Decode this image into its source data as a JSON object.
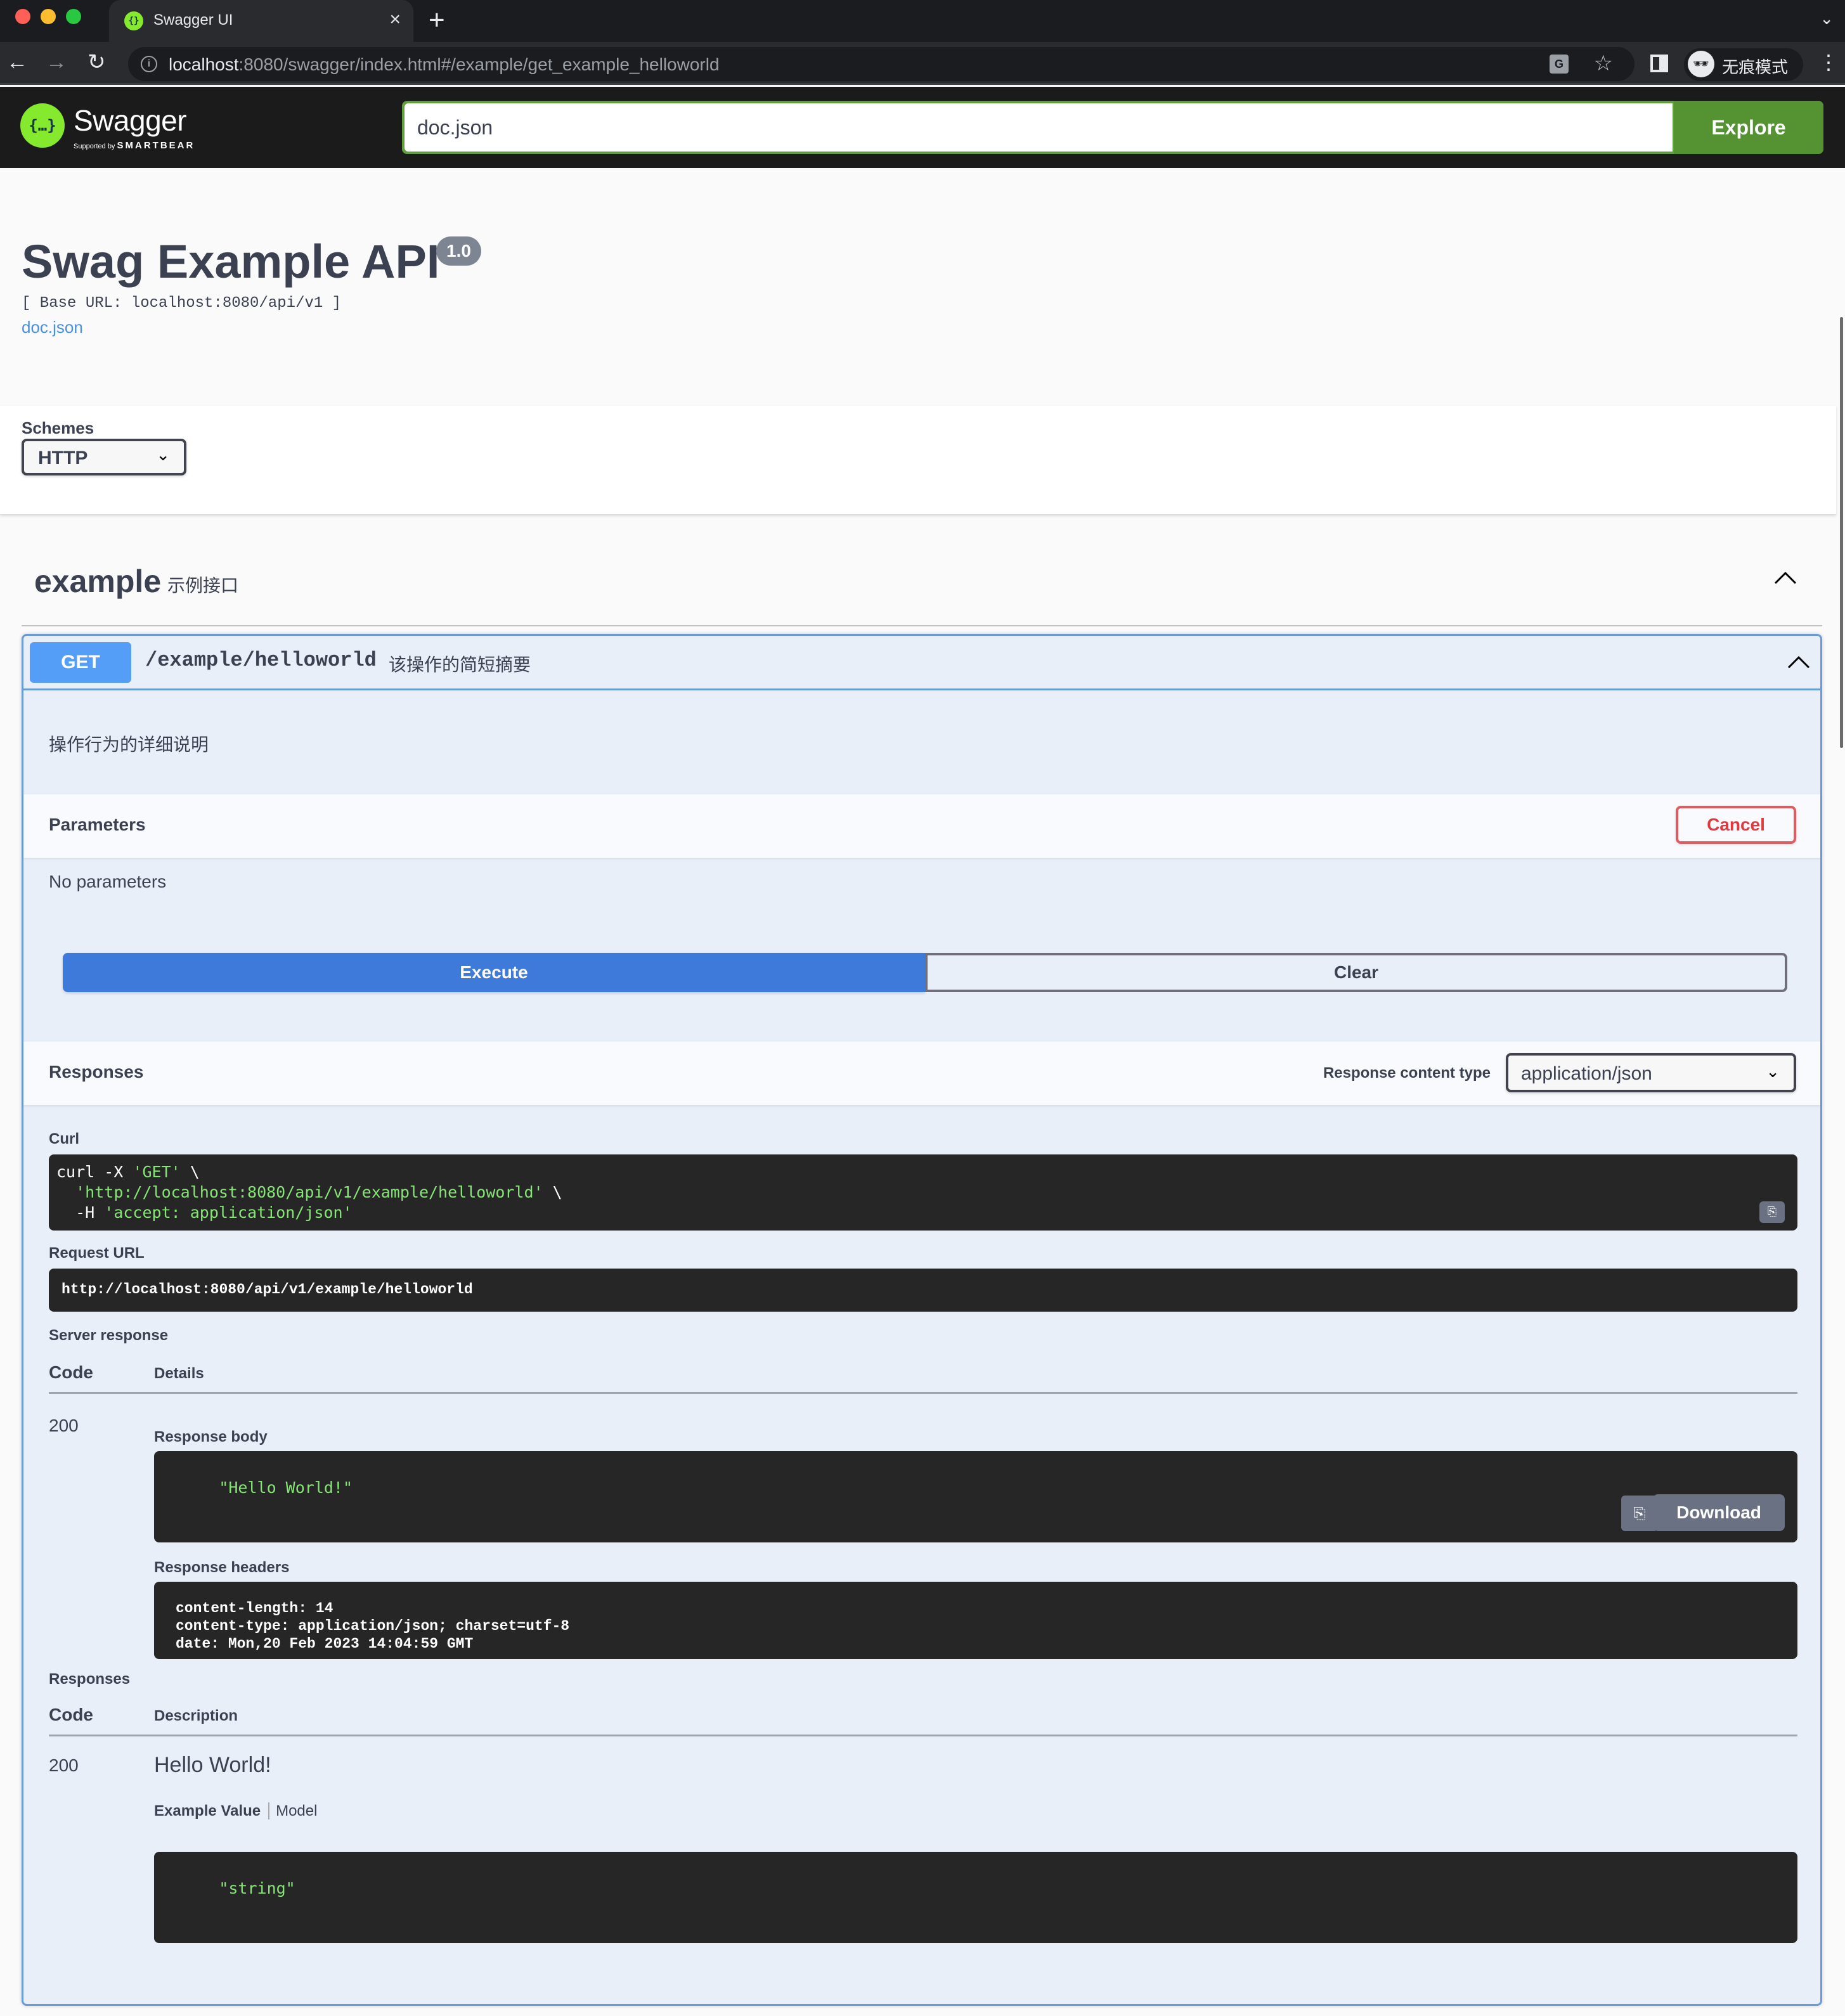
{
  "browser": {
    "tab_title": "Swagger UI",
    "url_host": "localhost",
    "url_rest": ":8080/swagger/index.html#/example/get_example_helloworld",
    "profile_label": "无痕模式",
    "icons": {
      "back": "arrow-left-icon",
      "forward": "arrow-right-icon",
      "reload": "reload-icon",
      "info": "info-icon",
      "translate": "translate-icon",
      "bookmark": "star-icon",
      "side_panel": "side-panel-icon",
      "incognito": "incognito-icon",
      "menu": "kebab-menu-icon"
    }
  },
  "topbar": {
    "logo_text": "Swagger",
    "logo_sub_prefix": "Supported by",
    "logo_sub_brand": "SMARTBEAR",
    "spec_url_value": "doc.json",
    "explore_label": "Explore",
    "colors": {
      "bg": "#1b1b1b",
      "accent": "#62a03f",
      "logo": "#85ea2d"
    }
  },
  "info": {
    "title": "Swag Example API",
    "version": "1.0",
    "base_url": "[ Base URL: localhost:8080/api/v1 ]",
    "spec_link": "doc.json"
  },
  "schemes": {
    "label": "Schemes",
    "selected": "HTTP"
  },
  "tag": {
    "name": "example",
    "description": "示例接口",
    "expanded": true
  },
  "operation": {
    "method": "GET",
    "path": "/example/helloworld",
    "summary": "该操作的简短摘要",
    "description": "操作行为的详细说明",
    "method_color": "#61affe",
    "parameters": {
      "title": "Parameters",
      "cancel_label": "Cancel",
      "empty_text": "No parameters"
    },
    "execute_label": "Execute",
    "clear_label": "Clear",
    "responses_header": {
      "title": "Responses",
      "content_type_label": "Response content type",
      "content_type_value": "application/json"
    },
    "curl": {
      "label": "Curl",
      "line1_cmd": "curl -X ",
      "line1_str": "'GET'",
      "line1_tail": " \\",
      "line2_indent": "  ",
      "line2_str": "'http://localhost:8080/api/v1/example/helloworld'",
      "line2_tail": " \\",
      "line3_cmd": "  -H ",
      "line3_str": "'accept: application/json'"
    },
    "request_url": {
      "label": "Request URL",
      "value": "http://localhost:8080/api/v1/example/helloworld"
    },
    "server_response": {
      "label": "Server response",
      "col_code": "Code",
      "col_details": "Details",
      "code": "200",
      "body_label": "Response body",
      "body": "\"Hello World!\"",
      "download_label": "Download",
      "headers_label": "Response headers",
      "headers": [
        "content-length: 14",
        "content-type: application/json; charset=utf-8",
        "date: Mon,20 Feb 2023 14:04:59 GMT"
      ]
    },
    "responses": {
      "label": "Responses",
      "col_code": "Code",
      "col_description": "Description",
      "code": "200",
      "description": "Hello World!",
      "tab_example": "Example Value",
      "tab_model": "Model",
      "example": "\"string\""
    }
  }
}
